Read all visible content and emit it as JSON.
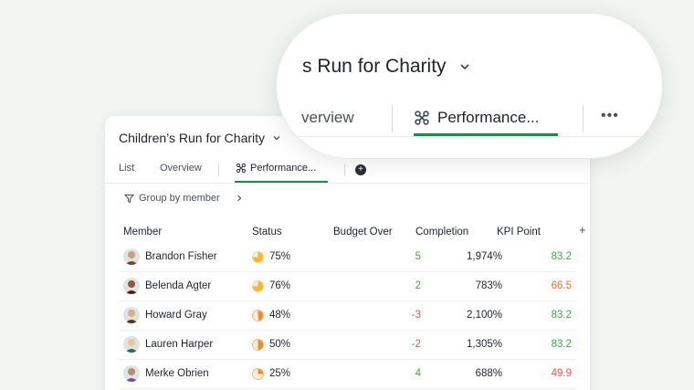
{
  "colors": {
    "accent": "#1e8a4a",
    "positive": "#3ea64a",
    "negative": "#e5534b",
    "warn": "#e8702a"
  },
  "project": {
    "title": "Children’s Run for Charity",
    "zoom_title": "s Run for Charity"
  },
  "tabs": [
    {
      "label": "List"
    },
    {
      "label": "Overview"
    },
    {
      "label": "Performance..."
    }
  ],
  "zoom_tabs": {
    "overview": "verview",
    "performance": "Performance..."
  },
  "toolbar": {
    "group_label": "Group by member"
  },
  "columns": {
    "member": "Member",
    "status": "Status",
    "budget": "Budget Over",
    "completion": "Completion",
    "kpi": "KPI Point"
  },
  "rows": [
    {
      "name": "Brandon Fisher",
      "status": "75%",
      "status_level": 0.75,
      "budget": "5",
      "budget_color": "#3ea64a",
      "completion": "1,974%",
      "kpi": "83.2",
      "kpi_color": "#3ea64a"
    },
    {
      "name": "Belenda Agter",
      "status": "76%",
      "status_level": 0.76,
      "budget": "2",
      "budget_color": "#3ea64a",
      "completion": "783%",
      "kpi": "66.5",
      "kpi_color": "#e8702a"
    },
    {
      "name": "Howard Gray",
      "status": "48%",
      "status_level": 0.48,
      "budget": "-3",
      "budget_color": "#e5534b",
      "completion": "2,100%",
      "kpi": "83.2",
      "kpi_color": "#3ea64a"
    },
    {
      "name": "Lauren Harper",
      "status": "50%",
      "status_level": 0.5,
      "budget": "-2",
      "budget_color": "#e5534b",
      "completion": "1,305%",
      "kpi": "83.2",
      "kpi_color": "#3ea64a"
    },
    {
      "name": "Merke Obrien",
      "status": "25%",
      "status_level": 0.25,
      "budget": "4",
      "budget_color": "#3ea64a",
      "completion": "688%",
      "kpi": "49.9",
      "kpi_color": "#e5534b"
    }
  ]
}
